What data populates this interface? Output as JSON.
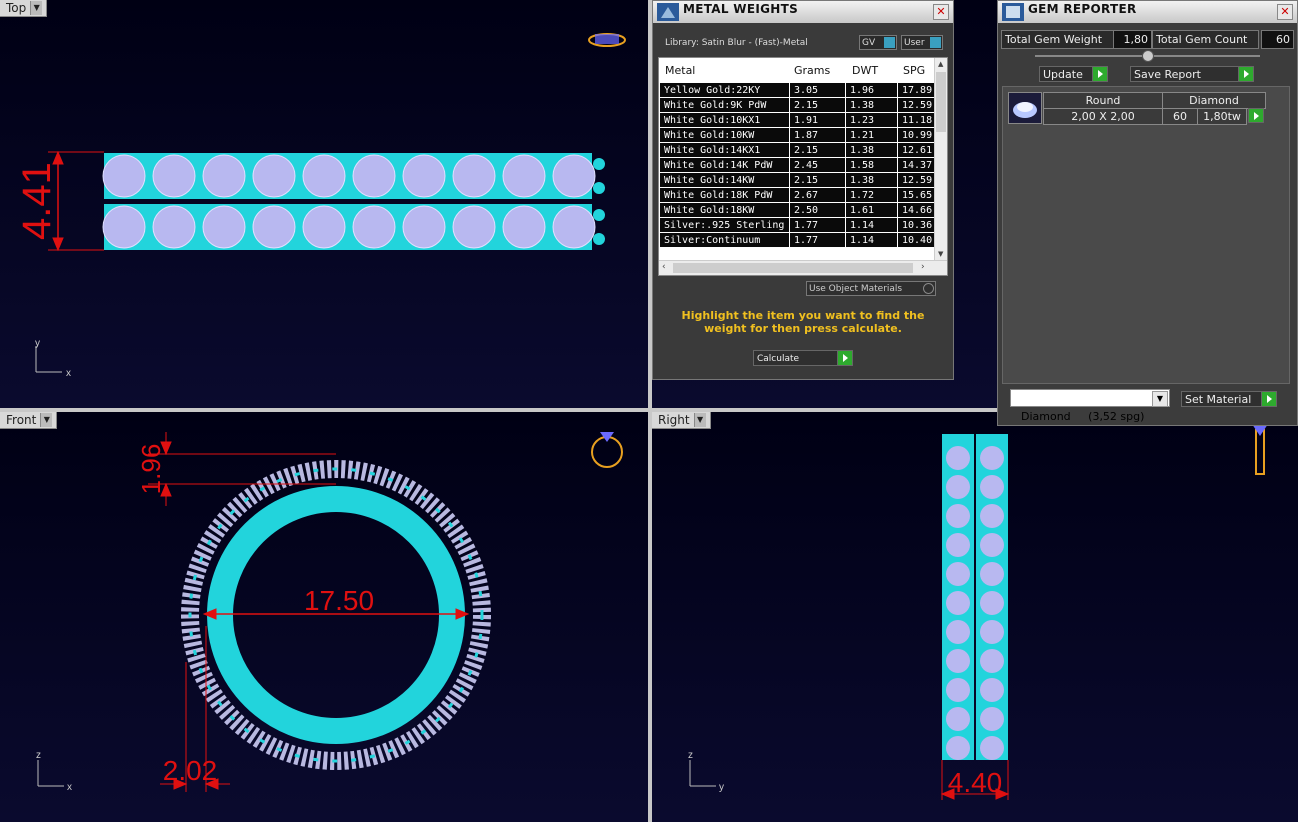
{
  "viewports": {
    "top": {
      "label": "Top",
      "axis_a": "y",
      "axis_b": "x",
      "dimension": "4.41"
    },
    "front": {
      "label": "Front",
      "axis_a": "z",
      "axis_b": "x",
      "dim_diameter": "17.50",
      "dim_height": "1.96",
      "dim_width": "2.02"
    },
    "right": {
      "label": "Right",
      "axis_a": "z",
      "axis_b": "y",
      "dimension": "4.40"
    }
  },
  "metal_weights": {
    "title": "METAL WEIGHTS",
    "library": "Library: Satin Blur - (Fast)-Metal",
    "gv_label": "GV",
    "user_label": "User",
    "columns": [
      "Metal",
      "Grams",
      "DWT",
      "SPG"
    ],
    "rows": [
      [
        "Yellow Gold:22KY",
        "3.05",
        "1.96",
        "17.89"
      ],
      [
        "White Gold:9K PdW",
        "2.15",
        "1.38",
        "12.59"
      ],
      [
        "White Gold:10KX1",
        "1.91",
        "1.23",
        "11.18"
      ],
      [
        "White Gold:10KW",
        "1.87",
        "1.21",
        "10.99"
      ],
      [
        "White Gold:14KX1",
        "2.15",
        "1.38",
        "12.61"
      ],
      [
        "White Gold:14K PdW",
        "2.45",
        "1.58",
        "14.37"
      ],
      [
        "White Gold:14KW",
        "2.15",
        "1.38",
        "12.59"
      ],
      [
        "White Gold:18K PdW",
        "2.67",
        "1.72",
        "15.65"
      ],
      [
        "White Gold:18KW",
        "2.50",
        "1.61",
        "14.66"
      ],
      [
        "Silver:.925 Sterling",
        "1.77",
        "1.14",
        "10.36"
      ],
      [
        "Silver:Continuum",
        "1.77",
        "1.14",
        "10.40"
      ]
    ],
    "use_object_materials": "Use Object Materials",
    "hint": "Highlight the item you want to find the weight for then press calculate.",
    "calculate_label": "Calculate"
  },
  "gem_reporter": {
    "title": "GEM REPORTER",
    "total_weight_label": "Total Gem Weight",
    "total_weight_value": "1,80",
    "total_count_label": "Total Gem Count",
    "total_count_value": "60",
    "update_label": "Update",
    "save_report_label": "Save Report",
    "gem": {
      "shape": "Round",
      "material": "Diamond",
      "size": "2,00 X 2,00",
      "count": "60",
      "weight": "1,80tw"
    },
    "material_select": "Diamond     (3,52 spg)",
    "set_material_label": "Set Material"
  }
}
